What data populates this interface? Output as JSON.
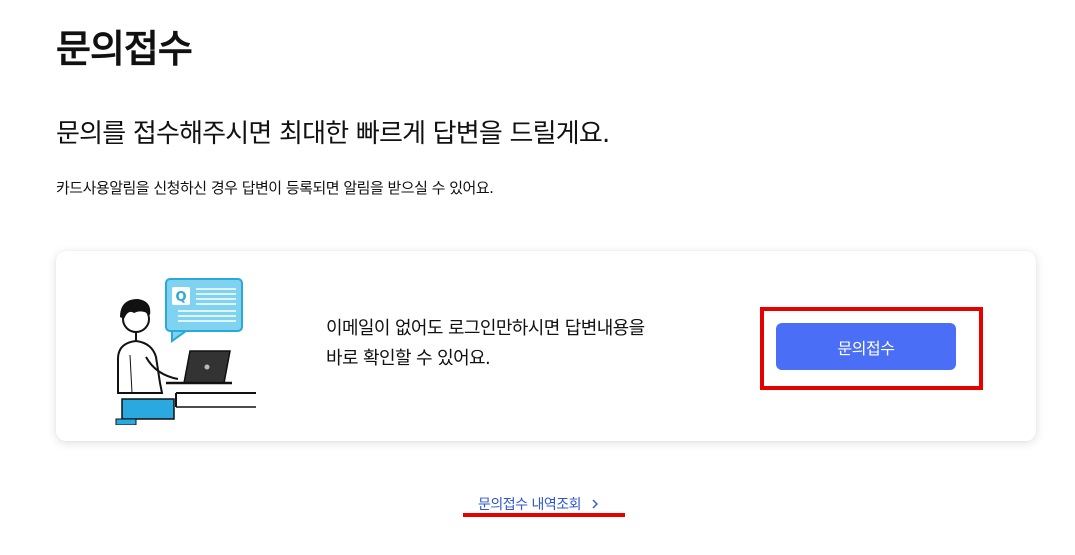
{
  "page": {
    "title": "문의접수",
    "headline": "문의를 접수해주시면 최대한 빠르게 답변을 드릴게요.",
    "subtext": "카드사용알림을 신청하신 경우 답변이 등록되면 알림을 받으실 수 있어요."
  },
  "card": {
    "message_line1": "이메일이 없어도 로그인만하시면 답변내용을",
    "message_line2": "바로 확인할 수 있어요.",
    "button_label": "문의접수",
    "illustration_bubble_letter": "Q"
  },
  "footer": {
    "history_link_label": "문의접수 내역조회"
  },
  "colors": {
    "button": "#4a6ef5",
    "link": "#2e55d8",
    "highlight": "#e60000",
    "bubble": "#7fd3f0"
  },
  "icons": {
    "illustration": "person-with-laptop-illustration",
    "link_arrow": "chevron-right-icon"
  }
}
